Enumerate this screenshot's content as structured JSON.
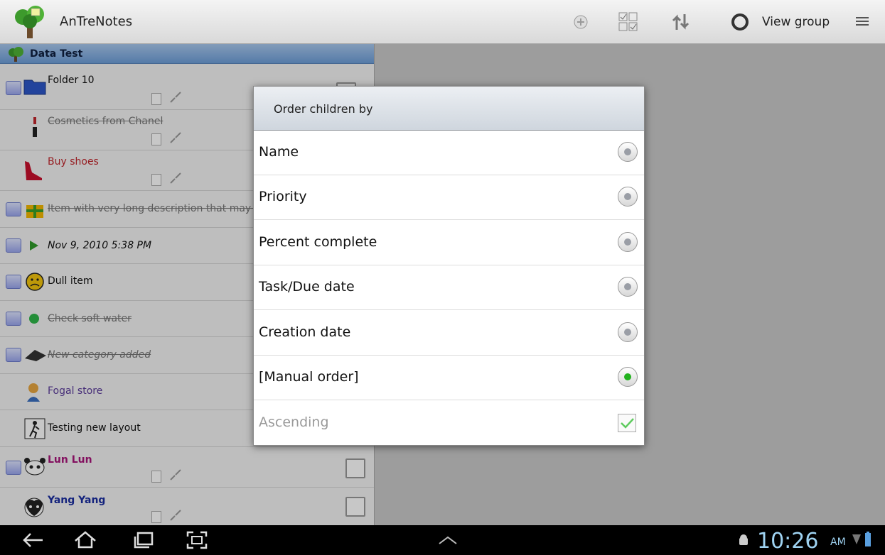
{
  "app": {
    "title": "AnTreNotes"
  },
  "actionbar": {
    "view_group_label": "View group"
  },
  "list": {
    "header": "Data Test",
    "items": [
      {
        "label": "Folder 10"
      },
      {
        "label": "Cosmetics from Chanel"
      },
      {
        "label": "Buy shoes"
      },
      {
        "label": "Item with very long description that may ta"
      },
      {
        "label": "Nov 9, 2010 5:38 PM"
      },
      {
        "label": "Dull item"
      },
      {
        "label": "Check soft water"
      },
      {
        "label": "New category added"
      },
      {
        "label": "Fogal store"
      },
      {
        "label": "Testing  new layout"
      },
      {
        "label": "Lun Lun"
      },
      {
        "label": "Yang Yang"
      }
    ]
  },
  "dialog": {
    "title": "Order children by",
    "options": [
      {
        "label": "Name",
        "selected": false
      },
      {
        "label": "Priority",
        "selected": false
      },
      {
        "label": "Percent complete",
        "selected": false
      },
      {
        "label": "Task/Due date",
        "selected": false
      },
      {
        "label": "Creation date",
        "selected": false
      },
      {
        "label": "[Manual order]",
        "selected": true
      }
    ],
    "ascending_label": "Ascending",
    "ascending_checked": true
  },
  "statusbar": {
    "time": "10:26",
    "ampm": "AM"
  },
  "colors": {
    "selected_radio": "#22b21e",
    "header_blue": "#6d9ed8",
    "clock": "#9fd3f2"
  }
}
